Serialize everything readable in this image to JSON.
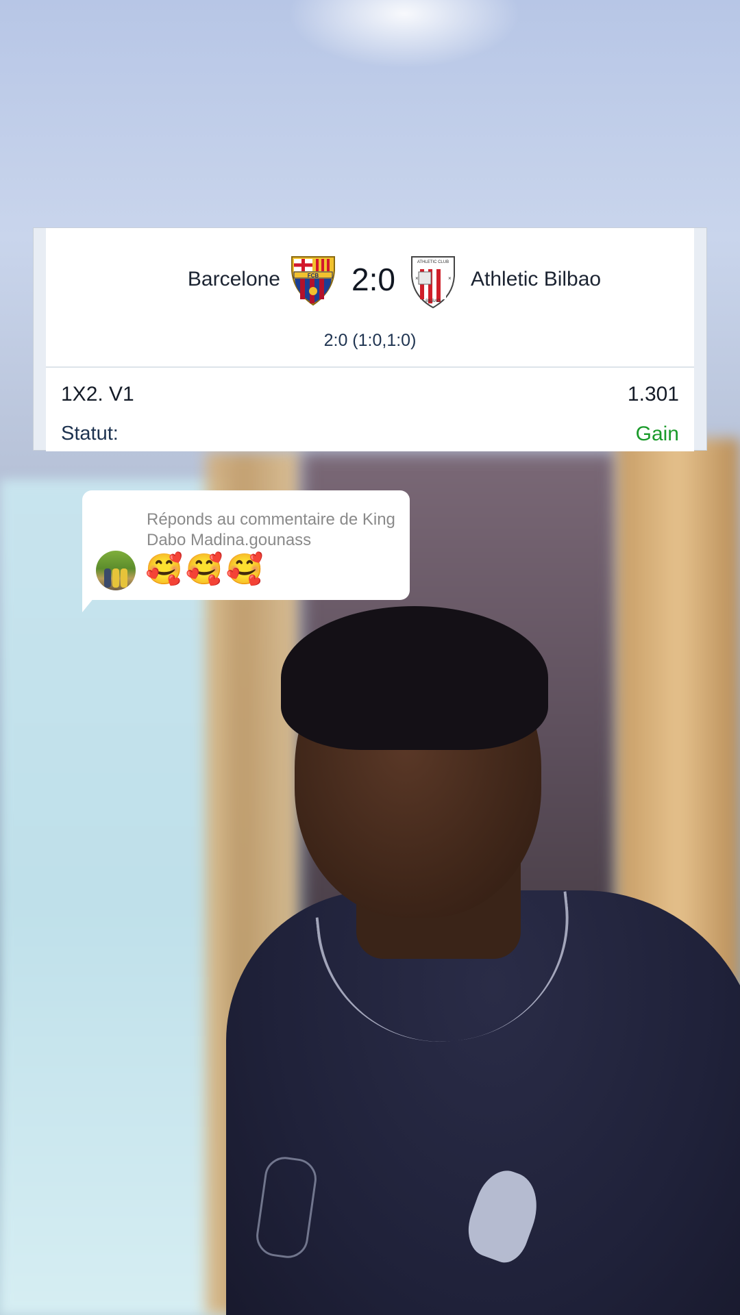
{
  "bet_card": {
    "home_team": "Barcelone",
    "away_team": "Athletic Bilbao",
    "score": "2:0",
    "score_detail": "2:0 (1:0,1:0)",
    "market": "1X2. V1",
    "odds": "1.301",
    "status_label": "Statut:",
    "status_value": "Gain",
    "status_color": "#1a9a2a",
    "home_crest_text": "FCB",
    "away_crest_text": "ATHLETIC CLUB",
    "away_crest_subtext": "BILBAO"
  },
  "reply": {
    "title": "Réponds au commentaire de King Dabo Madina.gounass",
    "emojis": "🥰🥰🥰"
  },
  "icons": {
    "home_crest": "barcelona-crest-icon",
    "away_crest": "athletic-bilbao-crest-icon",
    "avatar": "user-avatar"
  }
}
